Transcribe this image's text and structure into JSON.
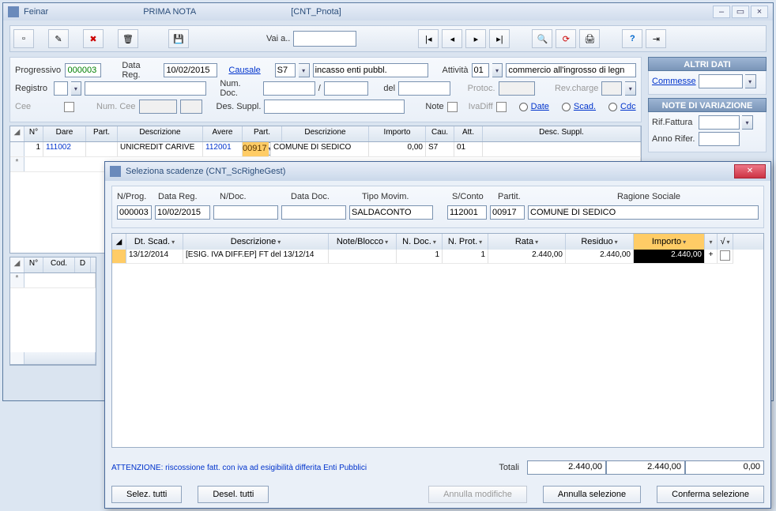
{
  "window": {
    "app": "Feinar",
    "title": "PRIMA NOTA",
    "form_id": "[CNT_Pnota]"
  },
  "toolbar": {
    "vai_a_label": "Vai a.."
  },
  "form": {
    "progressivo_lbl": "Progressivo",
    "progressivo": "000003",
    "data_reg_lbl": "Data Reg.",
    "data_reg": "10/02/2015",
    "causale_lbl": "Causale",
    "causale_code": "S7",
    "causale_desc": "incasso enti pubbl.",
    "attivita_lbl": "Attività",
    "attivita_code": "01",
    "attivita_desc": "commercio all'ingrosso di legn",
    "registro_lbl": "Registro",
    "num_doc_lbl": "Num. Doc.",
    "del_lbl": "del",
    "protoc_lbl": "Protoc.",
    "rev_charge_lbl": "Rev.charge",
    "cee_lbl": "Cee",
    "num_cee_lbl": "Num. Cee",
    "des_suppl_lbl": "Des. Suppl.",
    "note_lbl": "Note",
    "iva_diff_lbl": "IvaDiff",
    "date_link": "Date",
    "scad_link": "Scad.",
    "cdc_link": "Cdc"
  },
  "side": {
    "altri_dati": "ALTRI DATI",
    "commesse": "Commesse",
    "note_var": "NOTE DI VARIAZIONE",
    "rif_fattura": "Rif.Fattura",
    "anno_rifer": "Anno Rifer."
  },
  "grid1": {
    "headers": [
      "N°",
      "Dare",
      "Part.",
      "Descrizione",
      "Avere",
      "Part.",
      "Descrizione",
      "Importo",
      "Cau.",
      "Att.",
      "Desc. Suppl."
    ],
    "row": {
      "n": "1",
      "dare": "111002",
      "part_d": "",
      "desc_d": "UNICREDIT CARIVE",
      "avere": "112001",
      "part_a": "00917",
      "desc_a": "COMUNE DI SEDICO",
      "importo": "0,00",
      "cau": "S7",
      "att": "01",
      "suppl": ""
    }
  },
  "grid2": {
    "headers": [
      "N°",
      "Cod.",
      "D"
    ]
  },
  "modal": {
    "title": "Seleziona scadenze  (CNT_ScRigheGest)",
    "labels": {
      "nprog": "N/Prog.",
      "data_reg": "Data Reg.",
      "ndoc": "N/Doc.",
      "data_doc": "Data Doc.",
      "tipo_movim": "Tipo Movim.",
      "sconto": "S/Conto",
      "partit": "Partit.",
      "rag_soc": "Ragione Sociale"
    },
    "values": {
      "nprog": "000003",
      "data_reg": "10/02/2015",
      "ndoc": "",
      "data_doc": "",
      "tipo_movim": "SALDACONTO",
      "sconto": "112001",
      "partit": "00917",
      "rag_soc": "COMUNE DI SEDICO"
    },
    "grid_headers": [
      "Dt. Scad.",
      "Descrizione",
      "Note/Blocco",
      "N. Doc.",
      "N. Prot.",
      "Rata",
      "Residuo",
      "Importo",
      "",
      "√"
    ],
    "grid_row": {
      "dt_scad": "13/12/2014",
      "descr": "[ESIG. IVA DIFF.EP] FT del 13/12/14",
      "note": "",
      "ndoc": "1",
      "nprot": "1",
      "rata": "2.440,00",
      "residuo": "2.440,00",
      "importo": "2.440,00",
      "plus": "+"
    },
    "warning": "ATTENZIONE: riscossione fatt. con iva ad esigibilità differita Enti Pubblici",
    "totali_lbl": "Totali",
    "totals": {
      "rata": "2.440,00",
      "residuo": "2.440,00",
      "importo": "0,00"
    },
    "buttons": {
      "selez_tutti": "Selez. tutti",
      "desel_tutti": "Desel. tutti",
      "annulla_mod": "Annulla modifiche",
      "annulla_sel": "Annulla selezione",
      "conferma_sel": "Conferma selezione"
    }
  }
}
